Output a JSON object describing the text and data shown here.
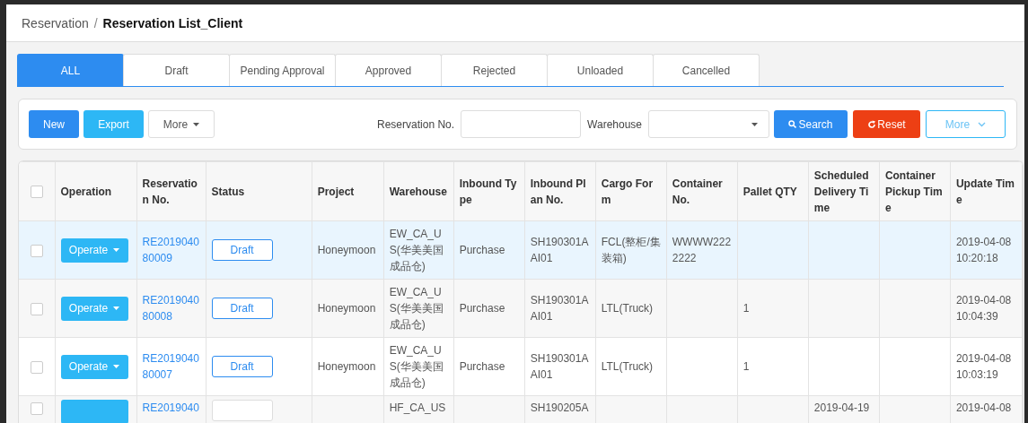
{
  "breadcrumb": {
    "parent": "Reservation",
    "separator": "/",
    "current": "Reservation List_Client"
  },
  "tabs": [
    {
      "label": "ALL",
      "selected": true
    },
    {
      "label": "Draft",
      "selected": false
    },
    {
      "label": "Pending Approval",
      "selected": false
    },
    {
      "label": "Approved",
      "selected": false
    },
    {
      "label": "Rejected",
      "selected": false
    },
    {
      "label": "Unloaded",
      "selected": false
    },
    {
      "label": "Cancelled",
      "selected": false
    }
  ],
  "toolbar": {
    "buttons": [
      {
        "label": "New",
        "kind": "primary"
      },
      {
        "label": "Export",
        "kind": "info"
      },
      {
        "label": "More",
        "kind": "dropdown"
      }
    ],
    "filters": [
      {
        "label": "Reservation No.",
        "kind": "text"
      },
      {
        "label": "Warehouse",
        "kind": "select"
      }
    ],
    "actions": [
      {
        "label": "Search",
        "kind": "search"
      },
      {
        "label": "Reset",
        "kind": "reset"
      },
      {
        "label": "More",
        "kind": "more"
      }
    ]
  },
  "table": {
    "select_all": {
      "checked": false
    },
    "columns": [
      "Operation",
      "Reservation No.",
      "Status",
      "Project",
      "Warehouse",
      "Inbound Type",
      "Inbound Plan No.",
      "Cargo Form",
      "Container No.",
      "Pallet QTY",
      "Scheduled Delivery Time",
      "Container Pickup Time",
      "Update Time"
    ],
    "rows": [
      {
        "selected": true,
        "checked": false,
        "operate": "Operate",
        "reservation_no": "RE201904080009",
        "status": "Draft",
        "project": "Honeymoon",
        "warehouse": "EW_CA_US(华美美国成品仓)",
        "inbound_type": "Purchase",
        "inbound_plan_no": "SH190301AAI01",
        "cargo_form": "FCL(整柜/集装箱)",
        "container_no": "WWWW2222222",
        "update_time": "2019-04-08 10:20:18"
      },
      {
        "selected": false,
        "checked": false,
        "operate": "Operate",
        "reservation_no": "RE201904080008",
        "status": "Draft",
        "project": "Honeymoon",
        "warehouse": "EW_CA_US(华美美国成品仓)",
        "inbound_type": "Purchase",
        "inbound_plan_no": "SH190301AAI01",
        "cargo_form": "LTL(Truck)",
        "pallet_qty": "1",
        "update_time": "2019-04-08 10:04:39"
      },
      {
        "selected": false,
        "checked": false,
        "operate": "Operate",
        "reservation_no": "RE201904080007",
        "status": "Draft",
        "project": "Honeymoon",
        "warehouse": "EW_CA_US(华美美国成品仓)",
        "inbound_type": "Purchase",
        "inbound_plan_no": "SH190301AAI01",
        "cargo_form": "LTL(Truck)",
        "pallet_qty": "1",
        "update_time": "2019-04-08 10:03:19"
      },
      {
        "selected": false,
        "checked": false,
        "reservation_no": "RE2019040",
        "warehouse": "HF_CA_US",
        "inbound_plan_no": "SH190205A",
        "scheduled_delivery_time": "2019-04-19",
        "update_time": "2019-04-08"
      }
    ]
  }
}
